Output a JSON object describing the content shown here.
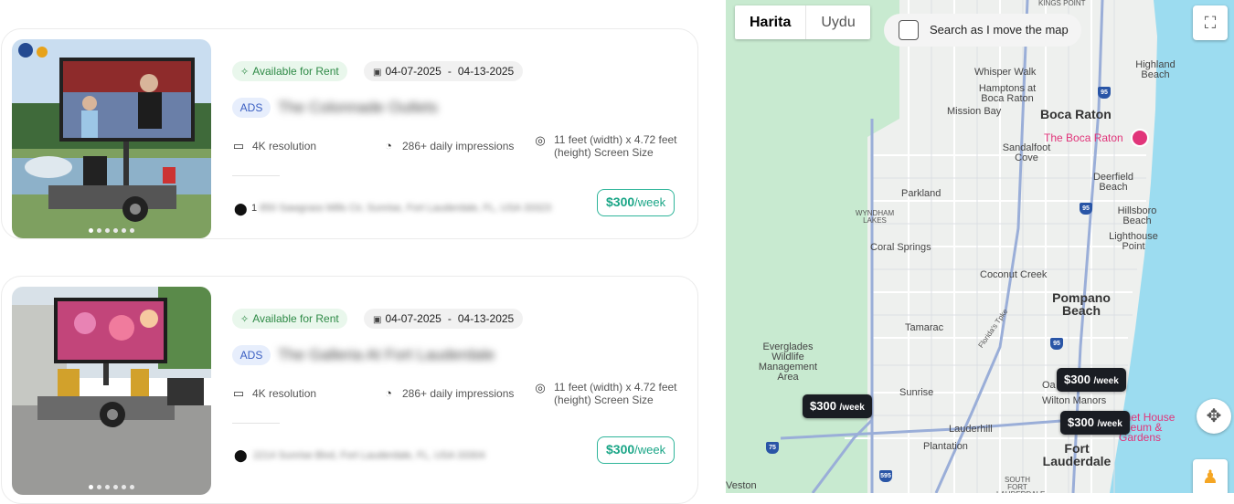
{
  "listings": [
    {
      "availability": "Available for Rent",
      "date_start": "04-07-2025",
      "date_sep": "-",
      "date_end": "04-13-2025",
      "badge": "ADS",
      "title": "The Colonnade Outlets",
      "resolution": "4K resolution",
      "impressions": "286+ daily impressions",
      "screen_size": "11 feet (width) x 4.72 feet (height) Screen Size",
      "address_prefix": "1",
      "address": "850 Sawgrass Mills Cir, Sunrise, Fort Lauderdale, FL, USA 33323",
      "price": "$300",
      "price_unit": "/week",
      "image_dots": 6,
      "image_active_dot": 0
    },
    {
      "availability": "Available for Rent",
      "date_start": "04-07-2025",
      "date_sep": "-",
      "date_end": "04-13-2025",
      "badge": "ADS",
      "title": "The Galleria At Fort Lauderdale",
      "resolution": "4K resolution",
      "impressions": "286+ daily impressions",
      "screen_size": "11 feet (width) x 4.72 feet (height) Screen Size",
      "address_prefix": "",
      "address": "2214 Sunrise Blvd, Fort Lauderdale, FL, USA 33304",
      "price": "$300",
      "price_unit": "/week",
      "image_dots": 6,
      "image_active_dot": 0
    }
  ],
  "map": {
    "map_type_map": "Harita",
    "map_type_satellite": "Uydu",
    "search_as_move": "Search as I move the map",
    "price_markers": [
      {
        "price": "$300",
        "unit": "/week"
      },
      {
        "price": "$300",
        "unit": "/week"
      },
      {
        "price": "$300",
        "unit": "/week"
      }
    ],
    "labels": {
      "kings_point": "KINGS POINT",
      "whisper_walk": "Whisper Walk",
      "hamptons": "Hamptons at Boca Raton",
      "mission_bay": "Mission Bay",
      "boca_raton": "Boca Raton",
      "the_boca_raton": "The Boca Raton",
      "highland_beach": "Highland Beach",
      "sandalfoot": "Sandalfoot Cove",
      "deerfield": "Deerfield Beach",
      "parkland": "Parkland",
      "hillsboro": "Hillsboro Beach",
      "wyndham": "WYNDHAM LAKES",
      "lighthouse": "Lighthouse Point",
      "coral_springs": "Coral Springs",
      "coconut_creek": "Coconut Creek",
      "pompano": "Pompano Beach",
      "tamarac": "Tamarac",
      "florida_tpke": "Florida's Tpke",
      "everglades": "Everglades Wildlife Management Area",
      "sunrise": "Sunrise",
      "oak": "Oa",
      "wilton": "Wilton Manors",
      "lauderhill": "Lauderhill",
      "plantation": "Plantation",
      "fort_lauderdale": "Fort Lauderdale",
      "south_fort": "SOUTH FORT LAUDERDALE",
      "weston": "Veston",
      "bonnet": "nnet House useum & Gardens"
    },
    "colors": {
      "water": "#9cdcf0",
      "green": "#c8ead0",
      "land": "#eef0ee",
      "road": "#ffffff",
      "highway": "#9aaed8"
    }
  }
}
